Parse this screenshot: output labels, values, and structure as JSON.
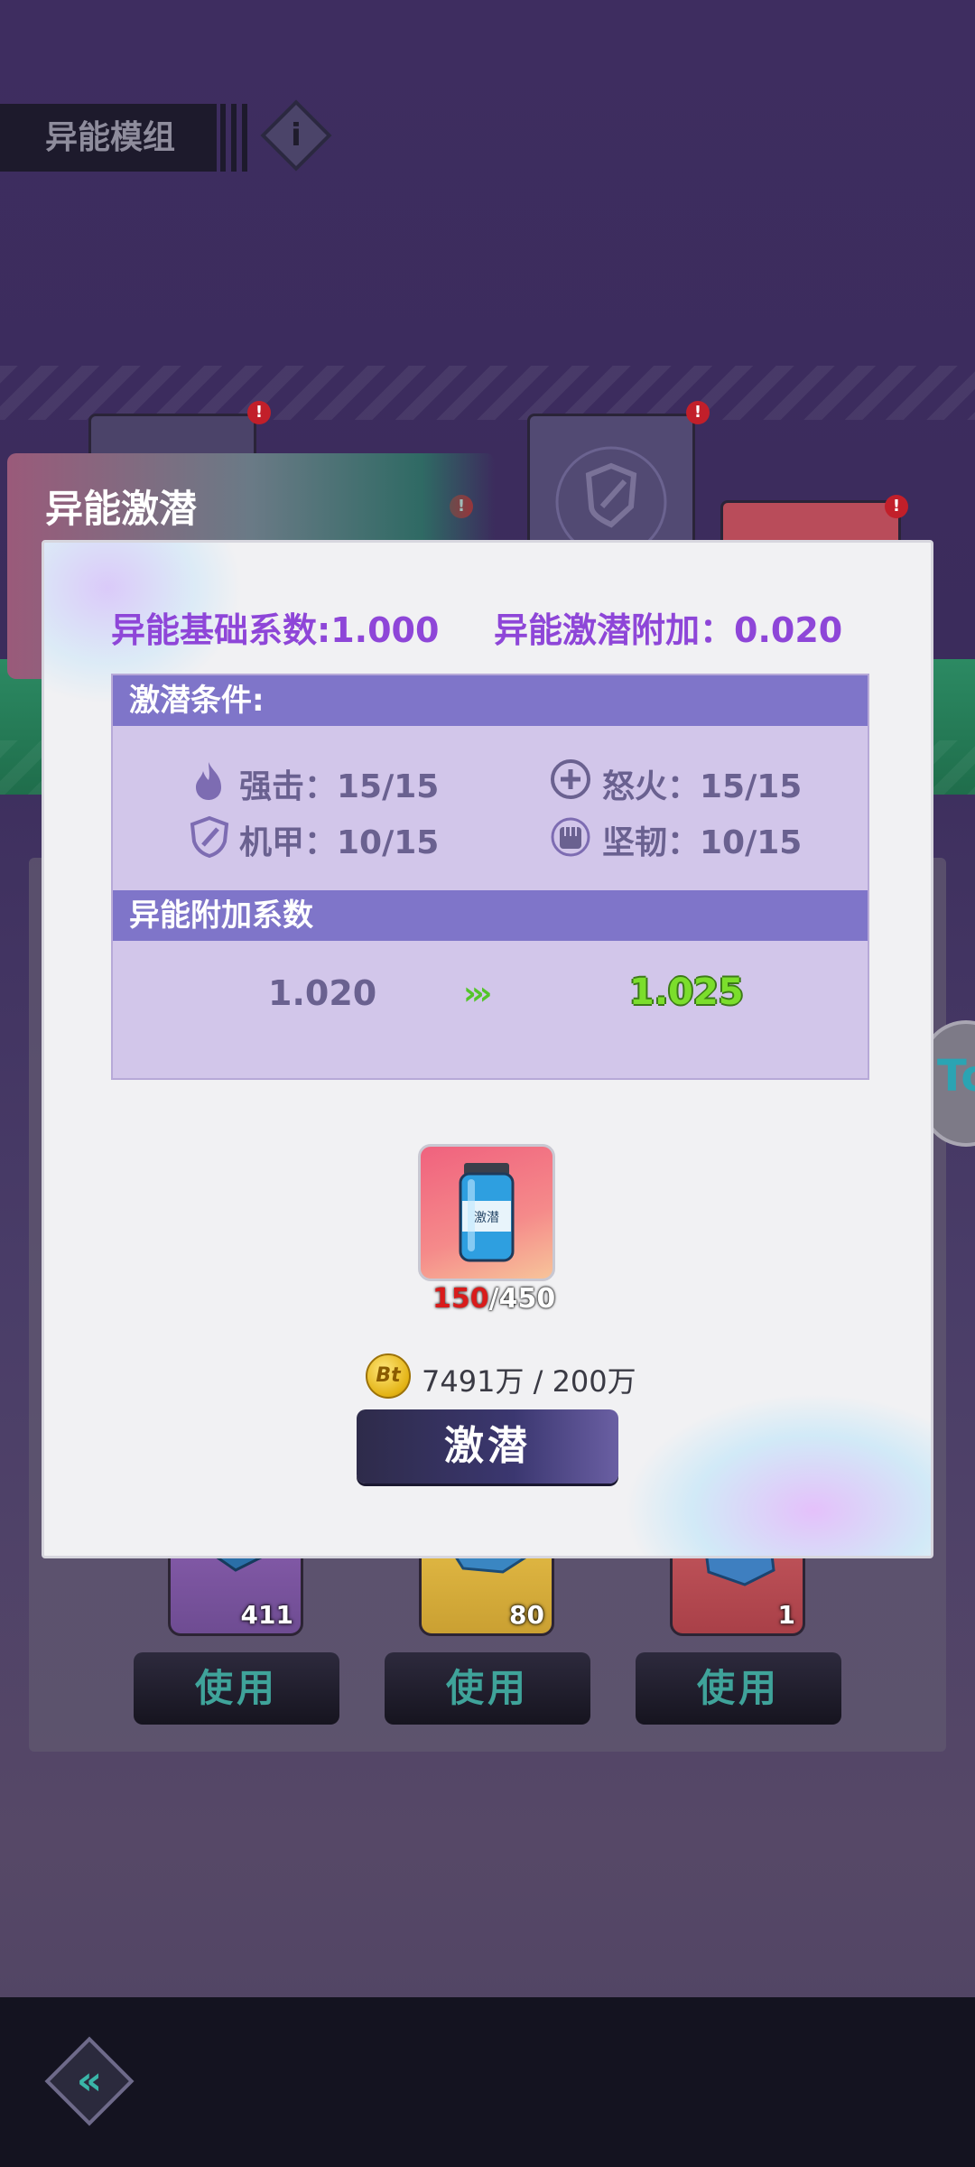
{
  "background": {
    "module_title": "异能模组",
    "info_icon": "info-icon",
    "inventory": [
      {
        "count": "411",
        "use_label": "使用"
      },
      {
        "count": "80",
        "use_label": "使用"
      },
      {
        "count": "1",
        "use_label": "使用"
      }
    ],
    "side_button_label": "To",
    "back_icon": "double-chevron-left-icon"
  },
  "dialog": {
    "title": "异能激潜",
    "base_coef": "异能基础系数:1.000",
    "awaken_bonus": "异能激潜附加：0.020",
    "conditions_header": "激潜条件:",
    "stats": [
      {
        "label": "强击：15/15",
        "icon": "flame-icon"
      },
      {
        "label": "怒火：15/15",
        "icon": "plus-circle-icon"
      },
      {
        "label": "机甲：10/15",
        "icon": "shield-icon"
      },
      {
        "label": "坚韧：10/15",
        "icon": "fist-icon"
      }
    ],
    "bonus_header": "异能附加系数",
    "bonus_old": "1.020",
    "bonus_new": "1.025",
    "arrow_glyph": "›››",
    "item": {
      "have": "150",
      "need": "/450",
      "icon": "serum-bottle-icon",
      "bottle_label": "激潜"
    },
    "coin": {
      "symbol": "Bt",
      "text": "7491万 / 200万"
    },
    "awaken_button": "激潜"
  },
  "colors": {
    "accent_purple": "#8e46d8",
    "section_header": "#7f75c9",
    "increase_green": "#7bde2c",
    "shortfall_red": "#d91b1b"
  }
}
